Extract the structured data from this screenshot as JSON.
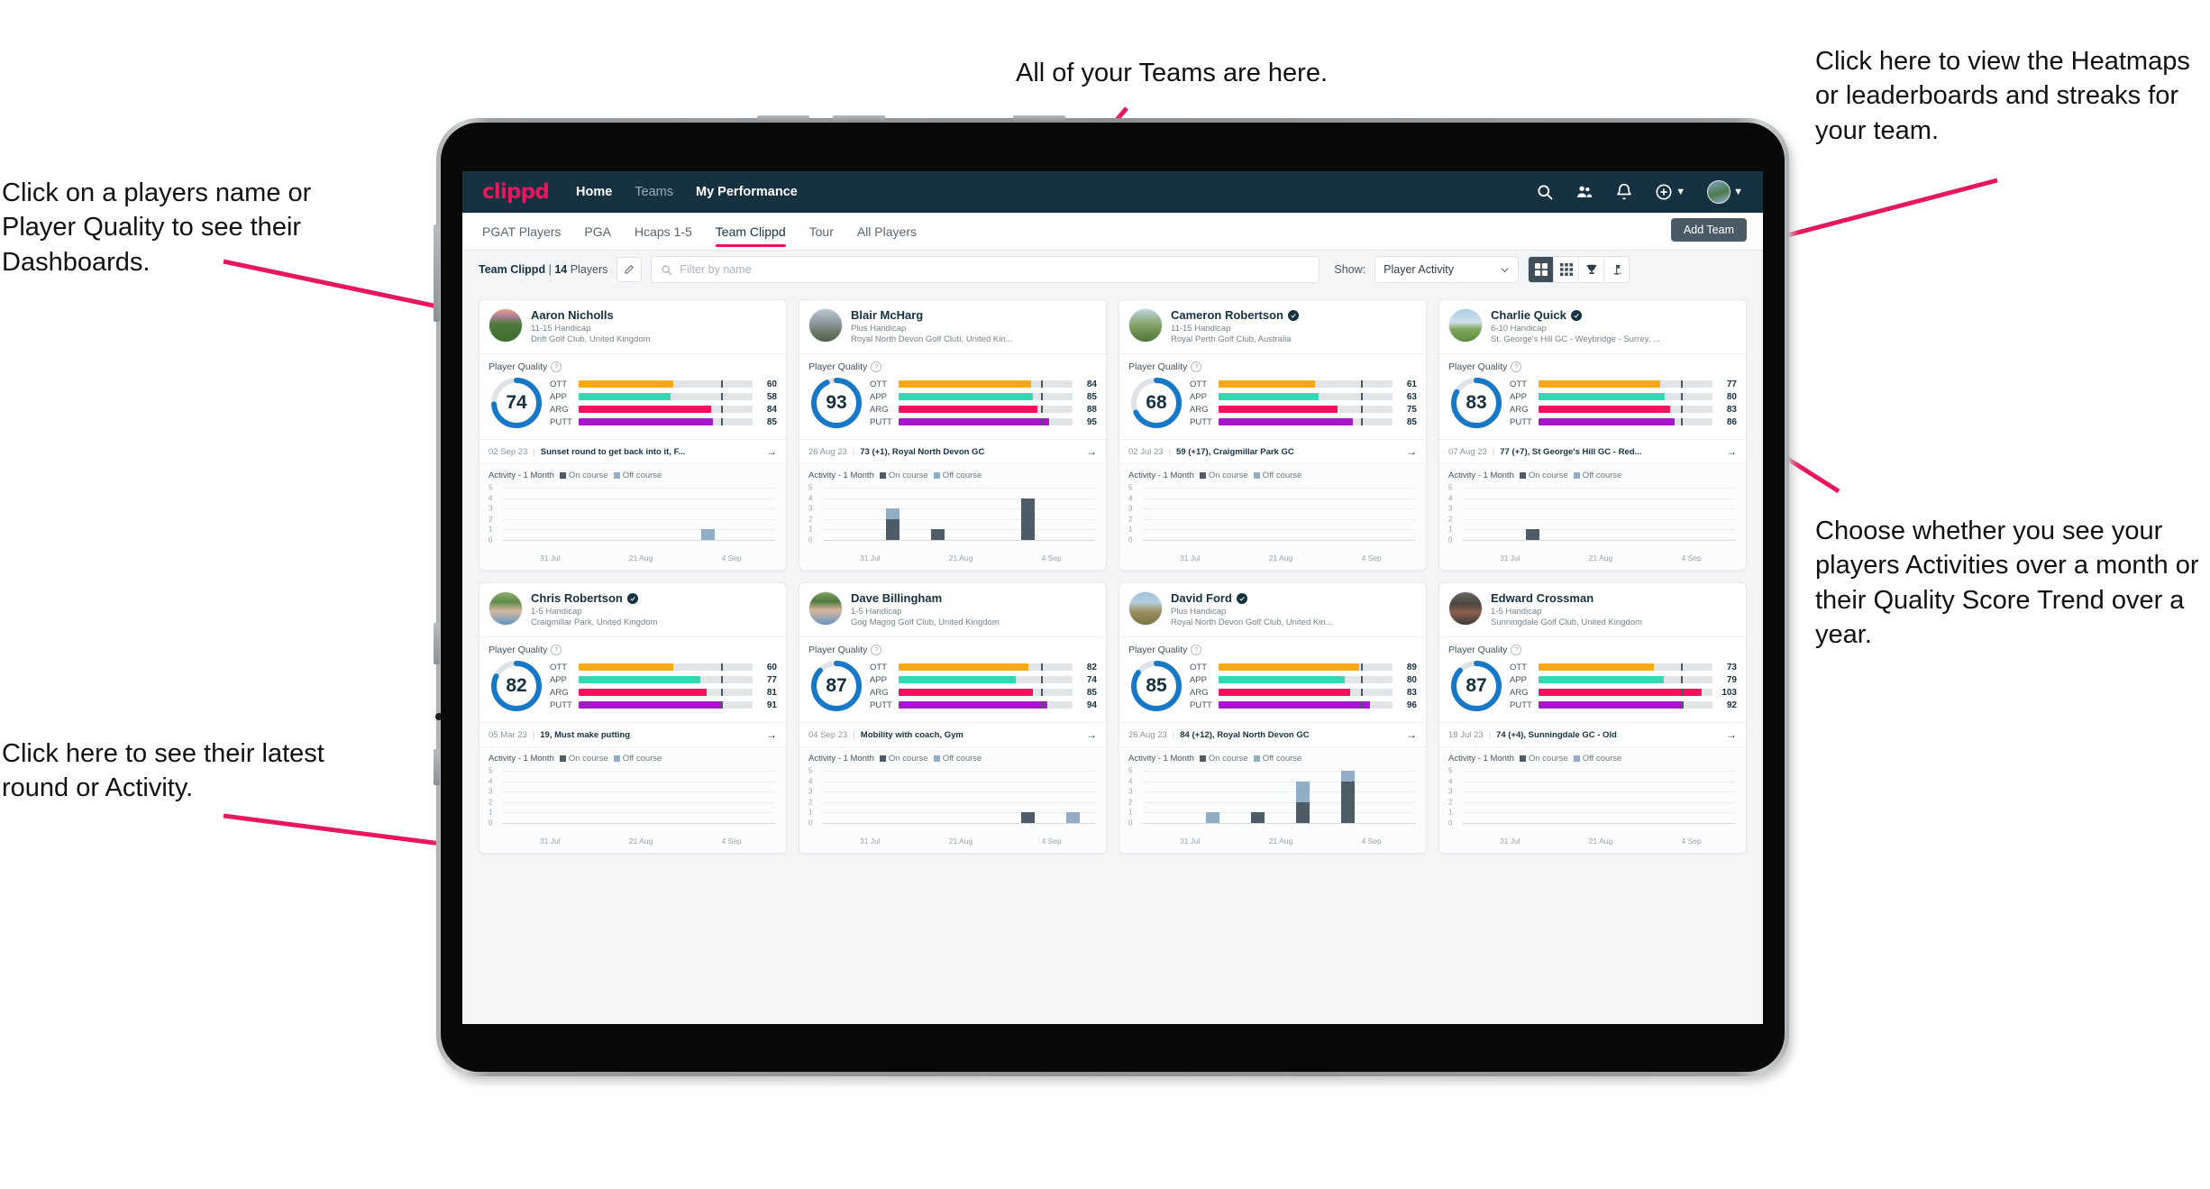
{
  "annotations": {
    "teams": "All of your Teams are here.",
    "heatmaps": "Click here to view the Heatmaps or leaderboards and streaks for your team.",
    "player_view": "Choose whether you see your players Activities over a month or their Quality Score Trend over a year.",
    "player_name": "Click on a players name or Player Quality to see their Dashboards.",
    "latest_round": "Click here to see their latest round or Activity.",
    "arrow_color": "#e8175d"
  },
  "header": {
    "brand": "clippd",
    "nav": [
      {
        "label": "Home",
        "active": true
      },
      {
        "label": "Teams",
        "active": false
      },
      {
        "label": "My Performance",
        "active": false
      }
    ],
    "icons": [
      "search-icon",
      "people-icon",
      "bell-icon",
      "plus-circle-icon",
      "avatar"
    ]
  },
  "tabs": {
    "items": [
      {
        "label": "PGAT Players",
        "active": false
      },
      {
        "label": "PGA",
        "active": false
      },
      {
        "label": "Hcaps 1-5",
        "active": false
      },
      {
        "label": "Team Clippd",
        "active": true
      },
      {
        "label": "Tour",
        "active": false
      },
      {
        "label": "All Players",
        "active": false
      }
    ],
    "add_team": "Add Team"
  },
  "filters": {
    "team_name": "Team Clippd",
    "team_count": "14",
    "team_count_suffix": "Players",
    "separator": "|",
    "edit_icon": "pencil-icon",
    "search_placeholder": "Filter by name",
    "search_value": "",
    "show_label": "Show:",
    "show_value": "Player Activity",
    "view_toggles": [
      {
        "name": "grid-view-icon",
        "active": true
      },
      {
        "name": "compact-grid-view-icon",
        "active": false
      },
      {
        "name": "trophy-view-icon",
        "active": false
      },
      {
        "name": "golf-flag-view-icon",
        "active": false
      }
    ]
  },
  "card_labels": {
    "player_quality": "Player Quality",
    "activity": "Activity - 1 Month",
    "on_course": "On course",
    "off_course": "Off course",
    "arrow": "→"
  },
  "colors": {
    "ott": "#f5a916",
    "app": "#37d6b0",
    "arg": "#f5125c",
    "putt": "#a618c9",
    "ring": "#1878c8",
    "ring_track": "#dfe3e7",
    "on_course": "#4e5c67",
    "off_course": "#92aec6",
    "brand": "#e8175d",
    "header_bg": "#16313f"
  },
  "chart_data": {
    "type": "bar",
    "ylim": [
      0,
      5
    ],
    "yticks": [
      5,
      4,
      3,
      2,
      1,
      0
    ],
    "xlabels": [
      "31 Jul",
      "21 Aug",
      "4 Sep"
    ],
    "series_names": [
      "On course",
      "Off course"
    ],
    "legend_position": "top"
  },
  "players": [
    {
      "name": "Aaron Nicholls",
      "verified": false,
      "handicap": "11-15 Handicap",
      "club": "Drift Golf Club, United Kingdom",
      "quality": 74,
      "metrics": [
        {
          "label": "OTT",
          "value": 60
        },
        {
          "label": "APP",
          "value": 58
        },
        {
          "label": "ARG",
          "value": 84
        },
        {
          "label": "PUTT",
          "value": 85
        }
      ],
      "round_date": "02 Sep 23",
      "round_text": "Sunset round to get back into it, F...",
      "avatar_css": "linear-gradient(180deg,#e6a47e 0%,#b07b9a 22%,#4d7c3a 45%,#3f6b2f 100%)",
      "activity": [
        {
          "slot": 0,
          "on": 0,
          "off": 0
        },
        {
          "slot": 1,
          "on": 0,
          "off": 0
        },
        {
          "slot": 2,
          "on": 0,
          "off": 0
        },
        {
          "slot": 3,
          "on": 0,
          "off": 0
        },
        {
          "slot": 4,
          "on": 0,
          "off": 1
        },
        {
          "slot": 5,
          "on": 0,
          "off": 0
        }
      ]
    },
    {
      "name": "Blair McHarg",
      "verified": false,
      "handicap": "Plus Handicap",
      "club": "Royal North Devon Golf Club, United Kin...",
      "quality": 93,
      "metrics": [
        {
          "label": "OTT",
          "value": 84
        },
        {
          "label": "APP",
          "value": 85
        },
        {
          "label": "ARG",
          "value": 88
        },
        {
          "label": "PUTT",
          "value": 95
        }
      ],
      "round_date": "26 Aug 23",
      "round_text": "73 (+1), Royal North Devon GC",
      "avatar_css": "linear-gradient(180deg,#b9c7cf 0%,#8f9aa2 40%,#6c7a6a 70%,#4d5f49 100%)",
      "activity": [
        {
          "slot": 0,
          "on": 0,
          "off": 0
        },
        {
          "slot": 1,
          "on": 2,
          "off": 1
        },
        {
          "slot": 2,
          "on": 1,
          "off": 0
        },
        {
          "slot": 3,
          "on": 0,
          "off": 0
        },
        {
          "slot": 4,
          "on": 4,
          "off": 0
        },
        {
          "slot": 5,
          "on": 0,
          "off": 0
        }
      ]
    },
    {
      "name": "Cameron Robertson",
      "verified": true,
      "handicap": "11-15 Handicap",
      "club": "Royal Perth Golf Club, Australia",
      "quality": 68,
      "metrics": [
        {
          "label": "OTT",
          "value": 61
        },
        {
          "label": "APP",
          "value": 63
        },
        {
          "label": "ARG",
          "value": 75
        },
        {
          "label": "PUTT",
          "value": 85
        }
      ],
      "round_date": "02 Jul 23",
      "round_text": "59 (+17), Craigmillar Park GC",
      "avatar_css": "linear-gradient(180deg,#bcd4e6 0%,#8fae7a 38%,#6d8f4e 70%,#55753c 100%)",
      "activity": [
        {
          "slot": 0,
          "on": 0,
          "off": 0
        },
        {
          "slot": 1,
          "on": 0,
          "off": 0
        },
        {
          "slot": 2,
          "on": 0,
          "off": 0
        },
        {
          "slot": 3,
          "on": 0,
          "off": 0
        },
        {
          "slot": 4,
          "on": 0,
          "off": 0
        },
        {
          "slot": 5,
          "on": 0,
          "off": 0
        }
      ]
    },
    {
      "name": "Charlie Quick",
      "verified": true,
      "handicap": "6-10 Handicap",
      "club": "St. George's Hill GC - Weybridge - Surrey, ...",
      "quality": 83,
      "metrics": [
        {
          "label": "OTT",
          "value": 77
        },
        {
          "label": "APP",
          "value": 80
        },
        {
          "label": "ARG",
          "value": 83
        },
        {
          "label": "PUTT",
          "value": 86
        }
      ],
      "round_date": "07 Aug 23",
      "round_text": "77 (+7), St George's Hill GC - Red...",
      "avatar_css": "linear-gradient(180deg,#a9cde4 0%,#cfe0ea 40%,#7fa65c 62%,#5d8a3e 100%)",
      "activity": [
        {
          "slot": 0,
          "on": 0,
          "off": 0
        },
        {
          "slot": 1,
          "on": 1,
          "off": 0
        },
        {
          "slot": 2,
          "on": 0,
          "off": 0
        },
        {
          "slot": 3,
          "on": 0,
          "off": 0
        },
        {
          "slot": 4,
          "on": 0,
          "off": 0
        },
        {
          "slot": 5,
          "on": 0,
          "off": 0
        }
      ]
    },
    {
      "name": "Chris Robertson",
      "verified": true,
      "handicap": "1-5 Handicap",
      "club": "Craigmillar Park, United Kingdom",
      "quality": 82,
      "metrics": [
        {
          "label": "OTT",
          "value": 60
        },
        {
          "label": "APP",
          "value": 77
        },
        {
          "label": "ARG",
          "value": 81
        },
        {
          "label": "PUTT",
          "value": 91
        }
      ],
      "round_date": "05 Mar 23",
      "round_text": "19, Must make putting",
      "avatar_css": "linear-gradient(180deg,#8fae6e 0%,#5f8a48 30%,#d7b9a2 58%,#5f93c4 100%)",
      "activity": [
        {
          "slot": 0,
          "on": 0,
          "off": 0
        },
        {
          "slot": 1,
          "on": 0,
          "off": 0
        },
        {
          "slot": 2,
          "on": 0,
          "off": 0
        },
        {
          "slot": 3,
          "on": 0,
          "off": 0
        },
        {
          "slot": 4,
          "on": 0,
          "off": 0
        },
        {
          "slot": 5,
          "on": 0,
          "off": 0
        }
      ]
    },
    {
      "name": "Dave Billingham",
      "verified": false,
      "handicap": "1-5 Handicap",
      "club": "Gog Magog Golf Club, United Kingdom",
      "quality": 87,
      "metrics": [
        {
          "label": "OTT",
          "value": 82
        },
        {
          "label": "APP",
          "value": 74
        },
        {
          "label": "ARG",
          "value": 85
        },
        {
          "label": "PUTT",
          "value": 94
        }
      ],
      "round_date": "04 Sep 23",
      "round_text": "Mobility with coach, Gym",
      "avatar_css": "linear-gradient(180deg,#7fa05e 0%,#4f7a3c 28%,#d8b59c 55%,#6694c2 100%)",
      "activity": [
        {
          "slot": 0,
          "on": 0,
          "off": 0
        },
        {
          "slot": 1,
          "on": 0,
          "off": 0
        },
        {
          "slot": 2,
          "on": 0,
          "off": 0
        },
        {
          "slot": 3,
          "on": 0,
          "off": 0
        },
        {
          "slot": 4,
          "on": 1,
          "off": 0
        },
        {
          "slot": 5,
          "on": 0,
          "off": 1
        }
      ]
    },
    {
      "name": "David Ford",
      "verified": true,
      "handicap": "Plus Handicap",
      "club": "Royal North Devon Golf Club, United Kin...",
      "quality": 85,
      "metrics": [
        {
          "label": "OTT",
          "value": 89
        },
        {
          "label": "APP",
          "value": 80
        },
        {
          "label": "ARG",
          "value": 83
        },
        {
          "label": "PUTT",
          "value": 96
        }
      ],
      "round_date": "26 Aug 23",
      "round_text": "84 (+12), Royal North Devon GC",
      "avatar_css": "linear-gradient(180deg,#9dc0da 0%,#b7cfe0 30%,#9a8f5e 60%,#7a7544 100%)",
      "activity": [
        {
          "slot": 0,
          "on": 0,
          "off": 0
        },
        {
          "slot": 1,
          "on": 0,
          "off": 1
        },
        {
          "slot": 2,
          "on": 1,
          "off": 0
        },
        {
          "slot": 3,
          "on": 2,
          "off": 2
        },
        {
          "slot": 4,
          "on": 4,
          "off": 1
        },
        {
          "slot": 5,
          "on": 0,
          "off": 0
        }
      ]
    },
    {
      "name": "Edward Crossman",
      "verified": false,
      "handicap": "1-5 Handicap",
      "club": "Sunningdale Golf Club, United Kingdom",
      "quality": 87,
      "metrics": [
        {
          "label": "OTT",
          "value": 73
        },
        {
          "label": "APP",
          "value": 79
        },
        {
          "label": "ARG",
          "value": 103
        },
        {
          "label": "PUTT",
          "value": 92
        }
      ],
      "round_date": "18 Jul 23",
      "round_text": "74 (+4), Sunningdale GC - Old",
      "avatar_css": "linear-gradient(180deg,#6e6a63 0%,#4a4640 35%,#8c5f4e 62%,#3a3833 100%)",
      "activity": [
        {
          "slot": 0,
          "on": 0,
          "off": 0
        },
        {
          "slot": 1,
          "on": 0,
          "off": 0
        },
        {
          "slot": 2,
          "on": 0,
          "off": 0
        },
        {
          "slot": 3,
          "on": 0,
          "off": 0
        },
        {
          "slot": 4,
          "on": 0,
          "off": 0
        },
        {
          "slot": 5,
          "on": 0,
          "off": 0
        }
      ]
    }
  ]
}
